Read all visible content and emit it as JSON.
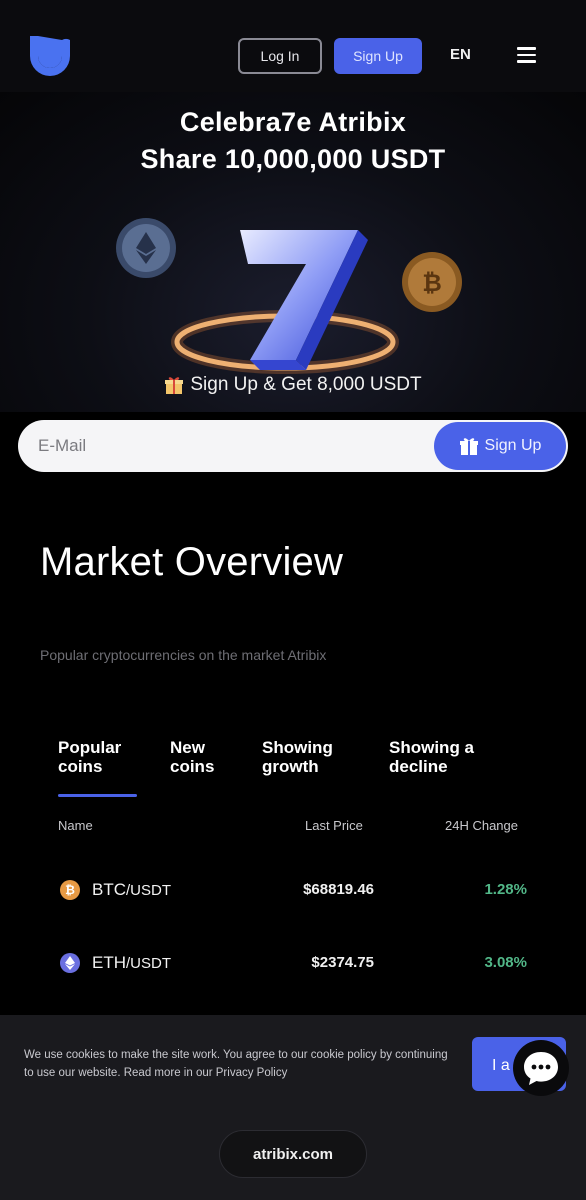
{
  "header": {
    "login_label": "Log In",
    "signup_label": "Sign Up",
    "language": "EN",
    "logo_icon": "atribix-logo-icon",
    "menu_icon": "hamburger-menu-icon"
  },
  "hero": {
    "title_line1": "Celebra7e Atribix",
    "title_line2": "Share 10,000,000 USDT",
    "promo": "Sign Up & Get 8,000 USDT",
    "promo_icon": "gift-icon",
    "big_number": "7",
    "coin_icons": [
      "ethereum-coin-icon",
      "bitcoin-coin-icon"
    ]
  },
  "signup_form": {
    "email_placeholder": "E-Mail",
    "submit_label": "Sign Up"
  },
  "market": {
    "title": "Market Overview",
    "subtitle": "Popular cryptocurrencies on the market Atribix",
    "tabs": [
      {
        "line1": "Popular",
        "line2": "coins",
        "active": true
      },
      {
        "line1": "New",
        "line2": "coins",
        "active": false
      },
      {
        "line1": "Showing",
        "line2": "growth",
        "active": false
      },
      {
        "line1": "Showing a",
        "line2": "decline",
        "active": false
      }
    ],
    "columns": {
      "name": "Name",
      "price": "Last Price",
      "change": "24H Change"
    },
    "rows": [
      {
        "base": "BTC",
        "quote": "/USDT",
        "price": "$68819.46",
        "change": "1.28%",
        "icon": "bitcoin-icon",
        "icon_color": "#e79a44"
      },
      {
        "base": "ETH",
        "quote": "/USDT",
        "price": "$2374.75",
        "change": "3.08%",
        "icon": "ethereum-icon",
        "icon_color": "#6a6fe0"
      }
    ],
    "positive_color": "#52b788"
  },
  "cookie": {
    "text": "We use cookies to make the site work. You agree to our cookie policy by continuing to use our website. Read more in our Privacy Policy",
    "accept_label": "I a",
    "chat_icon": "chat-bubble-icon"
  },
  "browser": {
    "url": "atribix.com"
  },
  "colors": {
    "accent": "#4a62e8",
    "background": "#000000"
  }
}
